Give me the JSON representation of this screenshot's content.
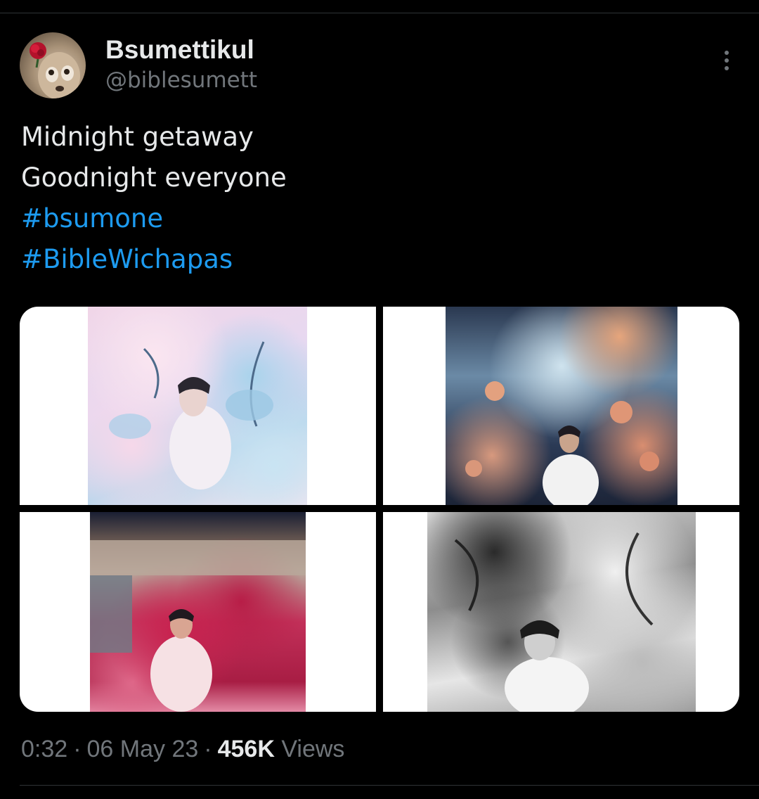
{
  "author": {
    "display_name": "Bsumettikul",
    "handle": "@biblesumett",
    "avatar_icon": "dog-with-rose-avatar"
  },
  "more_options_icon": "vertical-ellipsis-icon",
  "tweet": {
    "lines": [
      "Midnight getaway",
      "Goodnight everyone"
    ],
    "hashtags": [
      "#bsumone",
      "#BibleWichapas"
    ]
  },
  "media": [
    {
      "icon": "photo-pastel-flowers-portrait"
    },
    {
      "icon": "photo-orange-blossoms-portrait"
    },
    {
      "icon": "photo-red-foliage-building-portrait"
    },
    {
      "icon": "photo-monochrome-leaves-portrait"
    }
  ],
  "meta": {
    "time": "0:32",
    "separator": "·",
    "date": "06 May 23",
    "views_count": "456K",
    "views_label": "Views"
  },
  "colors": {
    "background": "#000000",
    "text": "#e7e9ea",
    "secondary_text": "#71767b",
    "hashtag": "#1d9bf0",
    "divider": "#2f3336"
  }
}
